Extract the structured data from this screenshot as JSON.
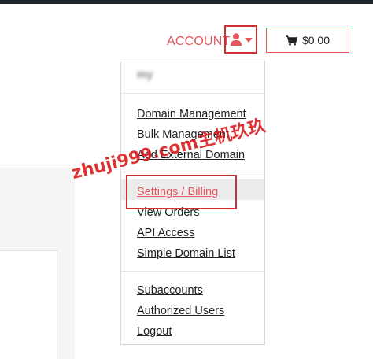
{
  "header": {
    "account_label": "ACCOUNT",
    "cart_label": "$0.00"
  },
  "dropdown": {
    "user_name": "my",
    "groups": [
      {
        "items": [
          {
            "label": "Domain Management"
          },
          {
            "label": "Bulk Management"
          },
          {
            "label": "Add External Domain"
          }
        ]
      },
      {
        "items": [
          {
            "label": "Settings / Billing",
            "active": true
          },
          {
            "label": "View Orders"
          },
          {
            "label": "API Access"
          },
          {
            "label": "Simple Domain List"
          }
        ]
      },
      {
        "items": [
          {
            "label": "Subaccounts"
          },
          {
            "label": "Authorized Users"
          },
          {
            "label": "Logout"
          }
        ]
      }
    ]
  },
  "watermark": {
    "text": "zhuji999.com主机玖玖"
  },
  "colors": {
    "accent": "#e5575d",
    "highlight_border": "#cf2f34",
    "watermark": "#d81e1e"
  },
  "icons": {
    "user": "user-icon",
    "caret": "caret-down-icon",
    "cart": "shopping-cart-icon"
  }
}
